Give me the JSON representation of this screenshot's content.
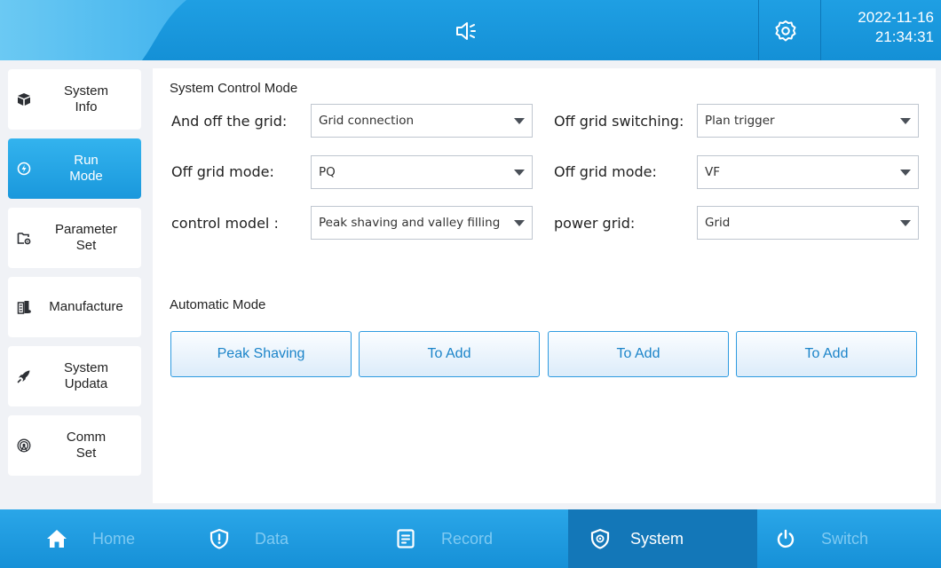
{
  "header": {
    "date": "2022-11-16",
    "time": "21:34:31",
    "icons": [
      "speaker-icon",
      "settings-gear-icon"
    ]
  },
  "sidebar": {
    "items": [
      {
        "label_line1": "System",
        "label_line2": "Info",
        "icon": "box-icon",
        "active": false
      },
      {
        "label_line1": "Run",
        "label_line2": "Mode",
        "icon": "power-icon",
        "active": true
      },
      {
        "label_line1": "Parameter",
        "label_line2": "Set",
        "icon": "folder-settings-icon",
        "active": false
      },
      {
        "label_line1": "Manufacture",
        "label_line2": "",
        "icon": "building-icon",
        "active": false
      },
      {
        "label_line1": "System",
        "label_line2": "Updata",
        "icon": "rocket-icon",
        "active": false
      },
      {
        "label_line1": "Comm",
        "label_line2": "Set",
        "icon": "antenna-icon",
        "active": false
      }
    ]
  },
  "control": {
    "title": "System Control Mode",
    "fields": [
      {
        "label": "And off the grid:",
        "value": "Grid connection"
      },
      {
        "label": "Off grid switching:",
        "value": "Plan trigger"
      },
      {
        "label": "Off grid mode:",
        "value": "PQ"
      },
      {
        "label": "Off grid mode:",
        "value": "VF"
      },
      {
        "label": "control model :",
        "value": "Peak shaving and valley filling"
      },
      {
        "label": "power grid:",
        "value": "Grid"
      }
    ]
  },
  "automatic": {
    "title": "Automatic Mode",
    "buttons": [
      "Peak Shaving",
      "To Add",
      "To Add",
      "To Add"
    ]
  },
  "nav": {
    "items": [
      {
        "label": "Home",
        "icon": "home-icon",
        "active": false
      },
      {
        "label": "Data",
        "icon": "shield-icon",
        "active": false
      },
      {
        "label": "Record",
        "icon": "document-icon",
        "active": false
      },
      {
        "label": "System",
        "icon": "shield-gear-icon",
        "active": true
      },
      {
        "label": "Switch",
        "icon": "power-icon",
        "active": false
      }
    ]
  },
  "colors": {
    "header_blue": "#1f9fe3",
    "active_blue": "#1a98dc",
    "nav_active": "#1377b8",
    "button_text": "#1b84c9"
  }
}
